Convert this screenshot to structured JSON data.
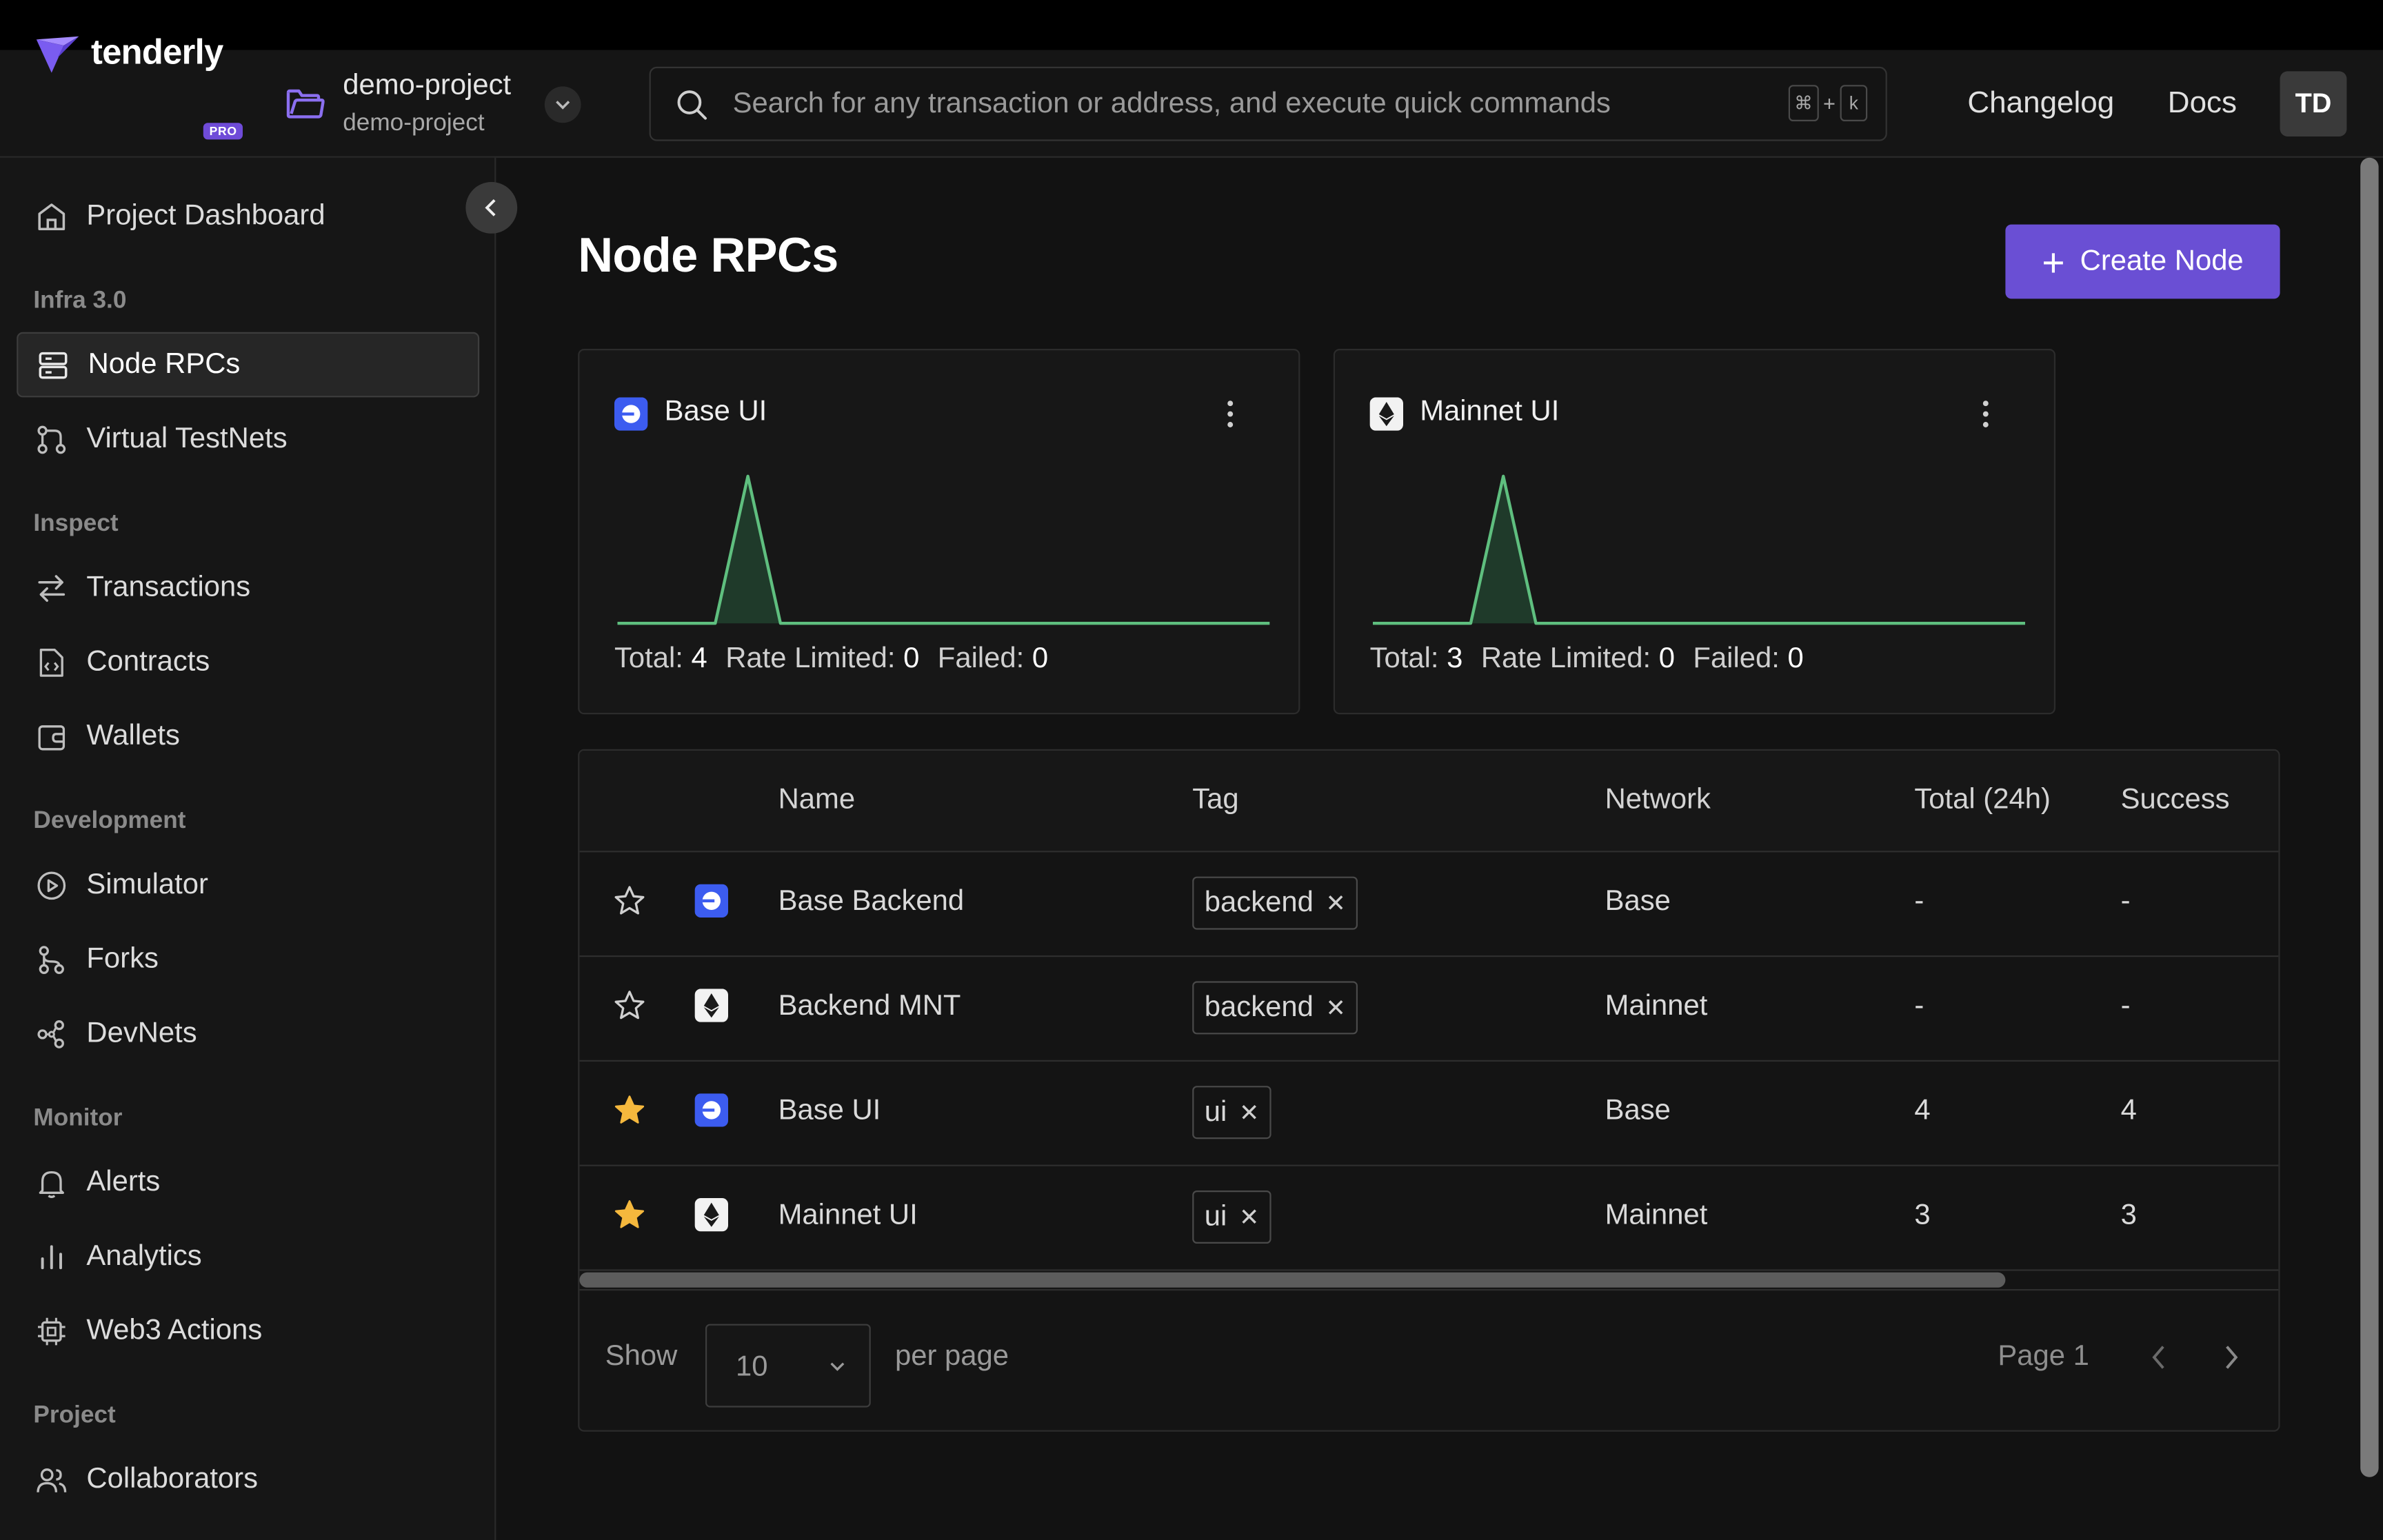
{
  "header": {
    "brand": "tenderly",
    "badge": "PRO",
    "project_name": "demo-project",
    "project_sub": "demo-project",
    "search_placeholder": "Search for any transaction or address, and execute quick commands",
    "shortcut_cmd": "⌘",
    "shortcut_plus": "+",
    "shortcut_key": "k",
    "changelog": "Changelog",
    "docs": "Docs",
    "avatar_initials": "TD"
  },
  "sidebar": {
    "dashboard": "Project Dashboard",
    "sections": {
      "infra": "Infra 3.0",
      "inspect": "Inspect",
      "development": "Development",
      "monitor": "Monitor",
      "project": "Project"
    },
    "items": {
      "node_rpcs": "Node RPCs",
      "virtual_testnets": "Virtual TestNets",
      "transactions": "Transactions",
      "contracts": "Contracts",
      "wallets": "Wallets",
      "simulator": "Simulator",
      "forks": "Forks",
      "devnets": "DevNets",
      "alerts": "Alerts",
      "analytics": "Analytics",
      "web3_actions": "Web3 Actions",
      "collaborators": "Collaborators"
    },
    "active_item": "node_rpcs"
  },
  "main": {
    "title": "Node RPCs",
    "create_button": "Create Node",
    "create_icon": "+",
    "cards": [
      {
        "name": "Base UI",
        "network_icon": "base-network-icon",
        "total_label": "Total:",
        "total": "4",
        "rate_limited_label": "Rate Limited:",
        "rate_limited": "0",
        "failed_label": "Failed:",
        "failed": "0",
        "spark": [
          0,
          0,
          0,
          0,
          1,
          0,
          0,
          0,
          0,
          0,
          0,
          0,
          0,
          0,
          0,
          0,
          0,
          0,
          0,
          0,
          0
        ]
      },
      {
        "name": "Mainnet UI",
        "network_icon": "ethereum-network-icon",
        "total_label": "Total:",
        "total": "3",
        "rate_limited_label": "Rate Limited:",
        "rate_limited": "0",
        "failed_label": "Failed:",
        "failed": "0",
        "spark": [
          0,
          0,
          0,
          0,
          1,
          0,
          0,
          0,
          0,
          0,
          0,
          0,
          0,
          0,
          0,
          0,
          0,
          0,
          0,
          0,
          0
        ]
      }
    ],
    "table": {
      "columns": [
        "Name",
        "Tag",
        "Network",
        "Total (24h)",
        "Success"
      ],
      "rows": [
        {
          "starred": false,
          "network_icon": "base-network-icon",
          "name": "Base Backend",
          "tag": "backend",
          "network": "Base",
          "total": "-",
          "success": "-"
        },
        {
          "starred": false,
          "network_icon": "ethereum-network-icon",
          "name": "Backend MNT",
          "tag": "backend",
          "network": "Mainnet",
          "total": "-",
          "success": "-"
        },
        {
          "starred": true,
          "network_icon": "base-network-icon",
          "name": "Base UI",
          "tag": "ui",
          "network": "Base",
          "total": "4",
          "success": "4"
        },
        {
          "starred": true,
          "network_icon": "ethereum-network-icon",
          "name": "Mainnet UI",
          "tag": "ui",
          "network": "Mainnet",
          "total": "3",
          "success": "3"
        }
      ],
      "footer": {
        "show": "Show",
        "per_page_value": "10",
        "per_page": "per page",
        "page": "Page 1"
      }
    }
  },
  "colors": {
    "accent": "#6a4fd4",
    "chart_line": "#5fbf7f",
    "star_filled": "#f5b83d",
    "base_blue": "#3c5cf0"
  }
}
